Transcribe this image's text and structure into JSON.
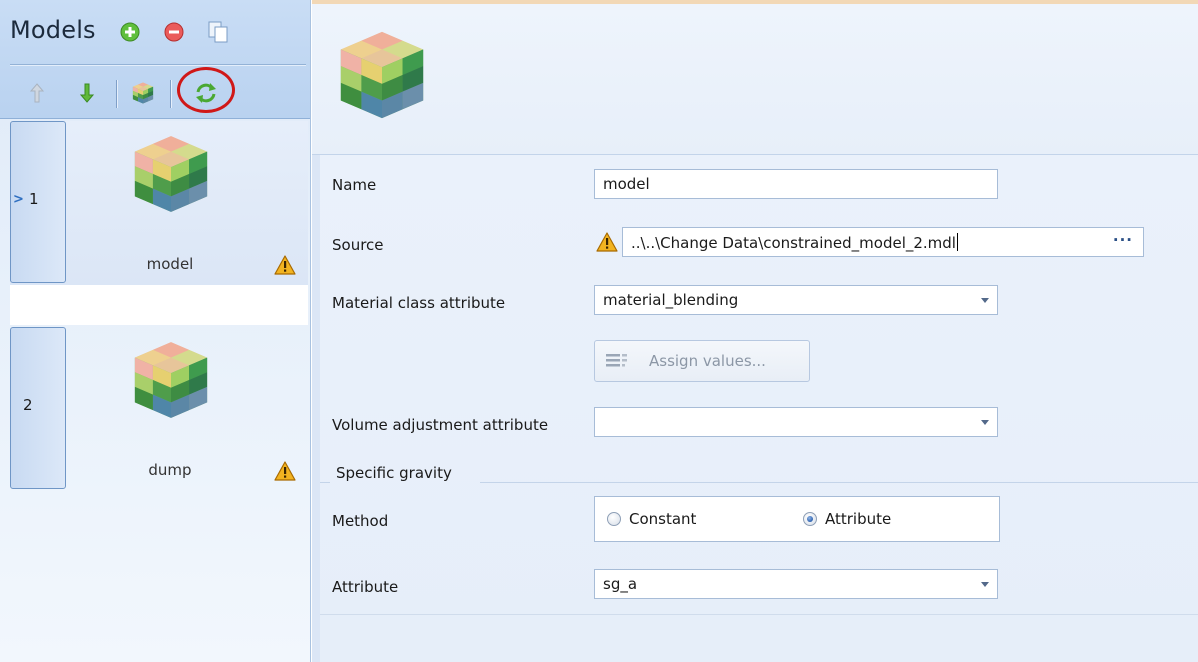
{
  "left_panel": {
    "title": "Models",
    "items": [
      {
        "number": "1",
        "name": "model",
        "selected": true,
        "warning": true
      },
      {
        "number": "2",
        "name": "dump",
        "selected": false,
        "warning": true
      }
    ]
  },
  "form": {
    "name_label": "Name",
    "name_value": "model",
    "source_label": "Source",
    "source_value": "..\\..\\Change Data\\constrained_model_2.mdl",
    "source_browse": "···",
    "material_label": "Material class attribute",
    "material_value": "material_blending",
    "assign_button": "Assign values...",
    "volume_label": "Volume adjustment attribute",
    "volume_value": "",
    "section_title": "Specific gravity",
    "method_label": "Method",
    "method_options": [
      {
        "label": "Constant",
        "selected": false
      },
      {
        "label": "Attribute",
        "selected": true
      }
    ],
    "attribute_label": "Attribute",
    "attribute_value": "sg_a"
  },
  "colors": {
    "accent": "#2f63b0",
    "annotation_circle": "#d01818",
    "warning": "#e8a317"
  }
}
